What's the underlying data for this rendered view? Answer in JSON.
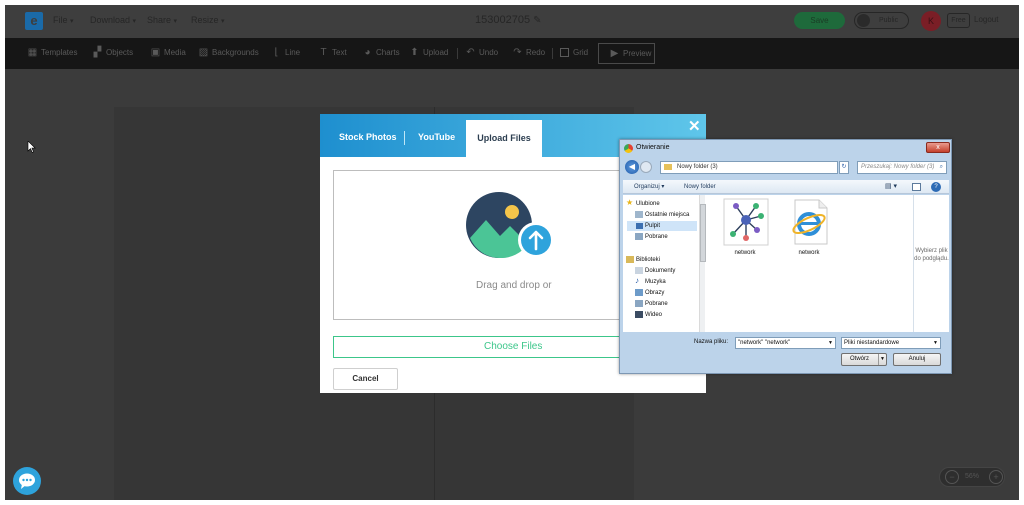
{
  "topbar": {
    "logo_letter": "e",
    "menus": [
      {
        "label": "File"
      },
      {
        "label": "Download"
      },
      {
        "label": "Share"
      },
      {
        "label": "Resize"
      }
    ],
    "document_title": "153002705",
    "save_label": "Save",
    "publish_label": "Public",
    "avatar_initial": "K",
    "plan_badge": "Free",
    "logout_label": "Logout"
  },
  "toolbar": {
    "items": [
      {
        "label": "Templates",
        "icon": "templates-icon"
      },
      {
        "label": "Objects",
        "icon": "objects-icon"
      },
      {
        "label": "Media",
        "icon": "media-icon"
      },
      {
        "label": "Backgrounds",
        "icon": "backgrounds-icon"
      },
      {
        "label": "Line",
        "icon": "line-icon"
      },
      {
        "label": "Text",
        "icon": "text-icon"
      },
      {
        "label": "Charts",
        "icon": "charts-icon"
      },
      {
        "label": "Upload",
        "icon": "upload-icon"
      },
      {
        "label": "Undo",
        "icon": "undo-icon"
      },
      {
        "label": "Redo",
        "icon": "redo-icon"
      },
      {
        "label": "Grid",
        "icon": "grid-icon"
      },
      {
        "label": "Preview",
        "icon": "play-icon"
      }
    ]
  },
  "zoom": {
    "value": "56%"
  },
  "upload_modal": {
    "tabs": [
      "Stock Photos",
      "YouTube",
      "Upload Files"
    ],
    "active_tab": "Upload Files",
    "close_glyph": "✕",
    "dropzone_text": "Drag and drop or",
    "choose_label": "Choose Files",
    "cancel_label": "Cancel",
    "colors": {
      "accent": "#3cc68a",
      "header_start": "#1e8fcf",
      "header_end": "#5fc6ea"
    }
  },
  "open_dialog": {
    "title": "Otwieranie",
    "close_glyph": "x",
    "address": "Nowy folder (3)",
    "search_placeholder": "Przeszukaj: Nowy folder (3)",
    "toolbar": {
      "organize": "Organizuj",
      "new_folder": "Nowy folder"
    },
    "nav_items": [
      {
        "label": "Ulubione",
        "icon": "star-icon"
      },
      {
        "label": "Ostatnie miejsca",
        "icon": "recent-places-icon"
      },
      {
        "label": "Pulpit",
        "icon": "desktop-icon"
      },
      {
        "label": "Pobrane",
        "icon": "downloads-icon"
      },
      {
        "label": "Biblioteki",
        "icon": "libraries-icon"
      },
      {
        "label": "Dokumenty",
        "icon": "documents-icon"
      },
      {
        "label": "Muzyka",
        "icon": "music-icon"
      },
      {
        "label": "Obrazy",
        "icon": "pictures-icon"
      },
      {
        "label": "Pobrane",
        "icon": "downloads-icon"
      },
      {
        "label": "Wideo",
        "icon": "video-icon"
      }
    ],
    "files": [
      {
        "name": "network",
        "icon": "network-diagram-icon"
      },
      {
        "name": "network",
        "icon": "internet-explorer-icon"
      }
    ],
    "preview_text": "Wybierz plik do podglądu.",
    "filename_label": "Nazwa pliku:",
    "filename_value": "\"network\" \"network\"",
    "filetype_value": "Pliki niestandardowe",
    "open_label": "Otwórz",
    "cancel_label": "Anuluj"
  }
}
